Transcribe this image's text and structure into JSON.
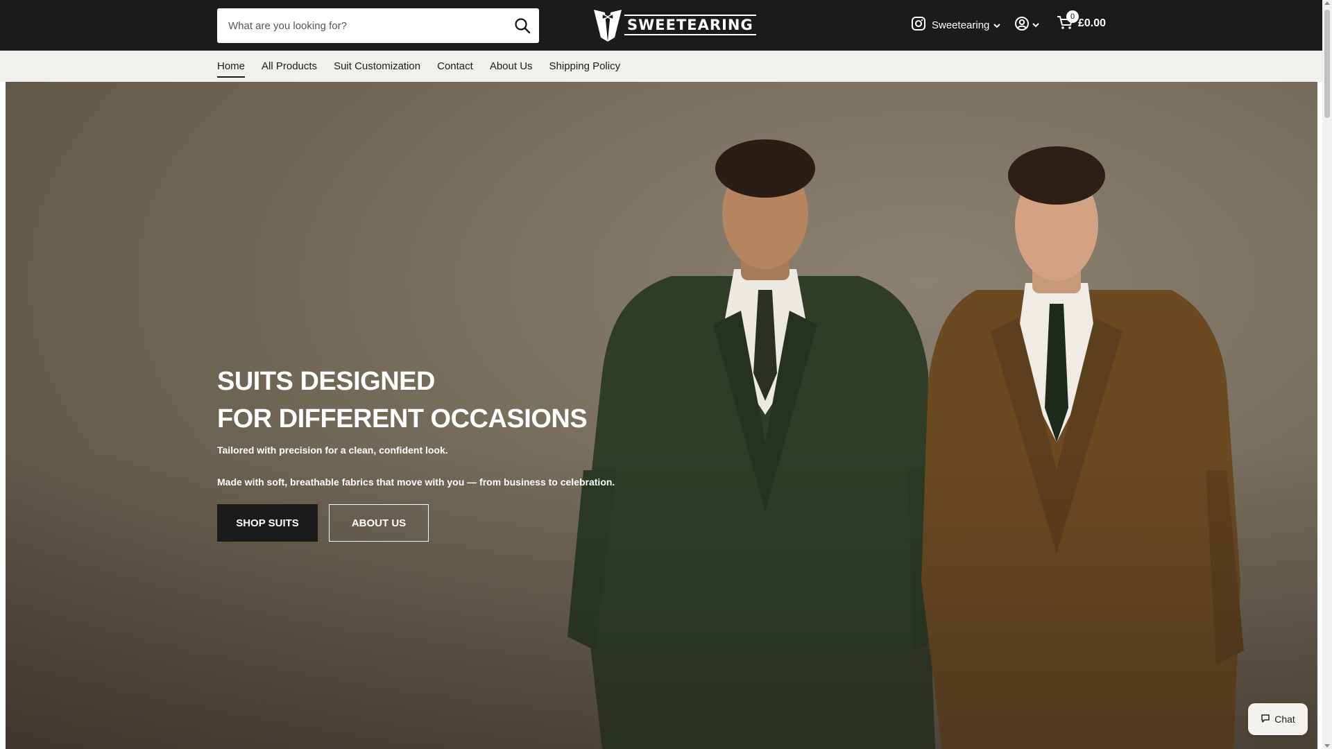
{
  "header": {
    "search": {
      "placeholder": "What are you looking for?",
      "value": ""
    },
    "logo_text": "SWEETEARING",
    "instagram_label": "Sweetearing",
    "cart": {
      "count": "0",
      "total": "£0.00"
    }
  },
  "nav": {
    "items": [
      {
        "label": "Home",
        "active": true
      },
      {
        "label": "All Products",
        "active": false
      },
      {
        "label": "Suit Customization",
        "active": false
      },
      {
        "label": "Contact",
        "active": false
      },
      {
        "label": "About Us",
        "active": false
      },
      {
        "label": "Shipping Policy",
        "active": false
      }
    ]
  },
  "hero": {
    "title_line1": "SUITS DESIGNED",
    "title_line2": "FOR DIFFERENT OCCASIONS",
    "paragraph1": "Tailored with precision for a clean, confident look.",
    "paragraph2": "Made with soft, breathable fabrics that move with you — from business to celebration.",
    "primary_button": "SHOP SUITS",
    "secondary_button": "ABOUT US"
  },
  "chat_label": "Chat",
  "colors": {
    "header_bg": "#1b1b1b",
    "nav_bg": "#f1f0ec",
    "hero_bg": "#7a705f",
    "green_suit": "#2f3d27",
    "brown_suit": "#6b4a22"
  },
  "icons": {
    "search": "search-icon",
    "instagram": "instagram-icon",
    "account": "user-circle-icon",
    "cart": "cart-icon",
    "chat": "chat-bubble-icon"
  }
}
